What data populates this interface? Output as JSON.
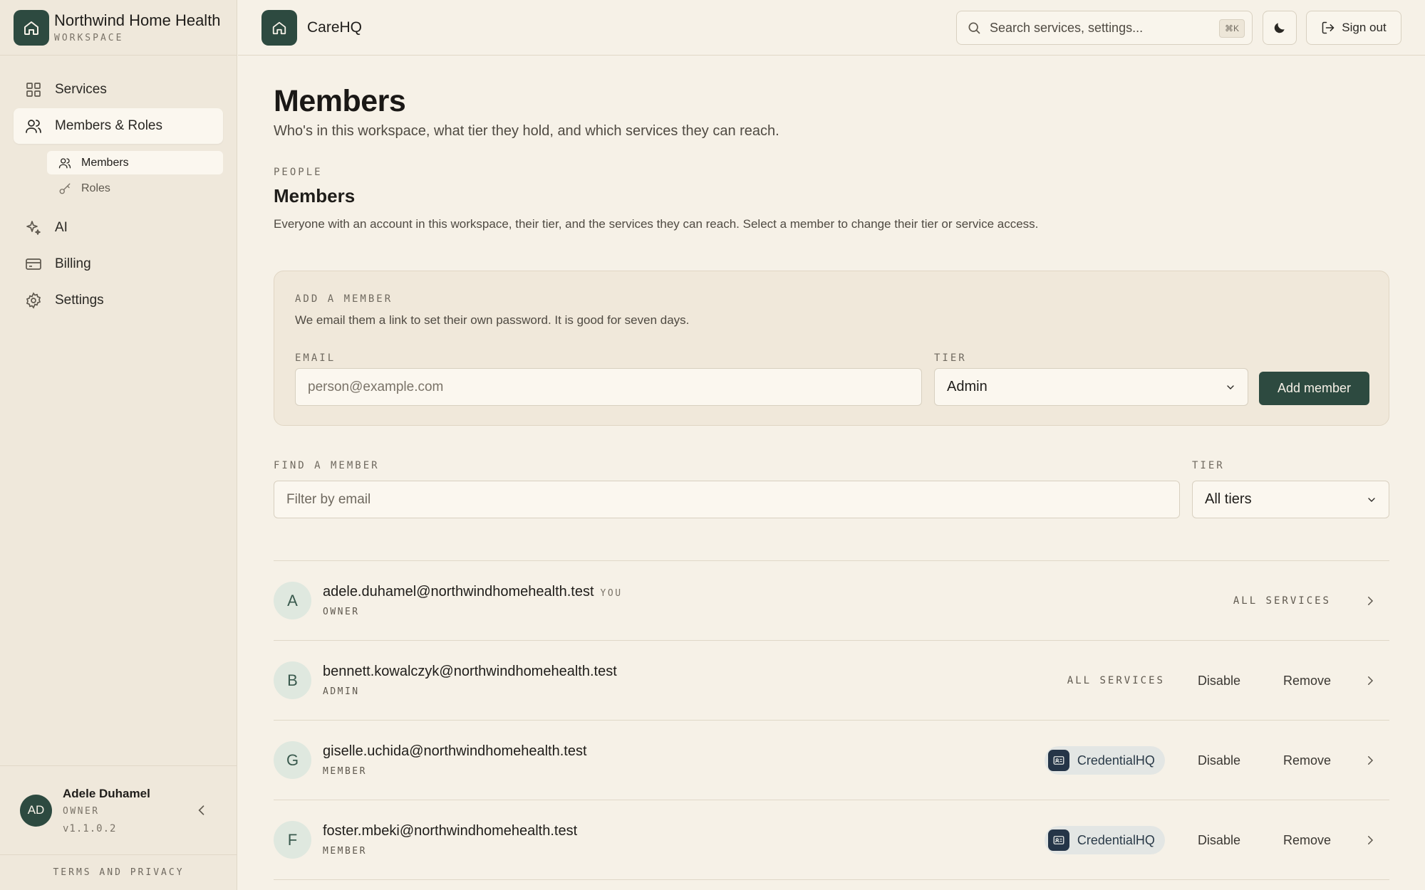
{
  "workspace": {
    "name": "Northwind Home Health",
    "label": "WORKSPACE"
  },
  "nav": {
    "services": "Services",
    "members_roles": "Members & Roles",
    "sub_members": "Members",
    "sub_roles": "Roles",
    "ai": "AI",
    "billing": "Billing",
    "settings": "Settings"
  },
  "user": {
    "initials": "AD",
    "name": "Adele Duhamel",
    "role": "OWNER",
    "version": "v1.1.0.2"
  },
  "footer": {
    "terms": "TERMS AND PRIVACY"
  },
  "topbar": {
    "app_name": "CareHQ",
    "search_placeholder": "Search services, settings...",
    "search_shortcut": "⌘K",
    "sign_out": "Sign out"
  },
  "page": {
    "title": "Members",
    "subtitle": "Who's in this workspace, what tier they hold, and which services they can reach.",
    "section_eyebrow": "PEOPLE",
    "section_title": "Members",
    "section_desc": "Everyone with an account in this workspace, their tier, and the services they can reach. Select a member to change their tier or service access."
  },
  "add_member": {
    "eyebrow": "ADD A MEMBER",
    "desc": "We email them a link to set their own password. It is good for seven days.",
    "email_label": "EMAIL",
    "email_placeholder": "person@example.com",
    "tier_label": "TIER",
    "tier_value": "Admin",
    "button": "Add member"
  },
  "find": {
    "label": "FIND A MEMBER",
    "placeholder": "Filter by email",
    "tier_label": "TIER",
    "tier_value": "All tiers"
  },
  "actions": {
    "disable": "Disable",
    "remove": "Remove"
  },
  "members": [
    {
      "initial": "A",
      "email": "adele.duhamel@northwindhomehealth.test",
      "you": "YOU",
      "tier": "OWNER",
      "access": "ALL SERVICES"
    },
    {
      "initial": "B",
      "email": "bennett.kowalczyk@northwindhomehealth.test",
      "tier": "ADMIN",
      "access": "ALL SERVICES"
    },
    {
      "initial": "G",
      "email": "giselle.uchida@northwindhomehealth.test",
      "tier": "MEMBER",
      "service": "CredentialHQ"
    },
    {
      "initial": "F",
      "email": "foster.mbeki@northwindhomehealth.test",
      "tier": "MEMBER",
      "service": "CredentialHQ"
    }
  ],
  "colors": {
    "brand": "#2d4a40",
    "background": "#f6f1e7",
    "chip": "#253548"
  }
}
